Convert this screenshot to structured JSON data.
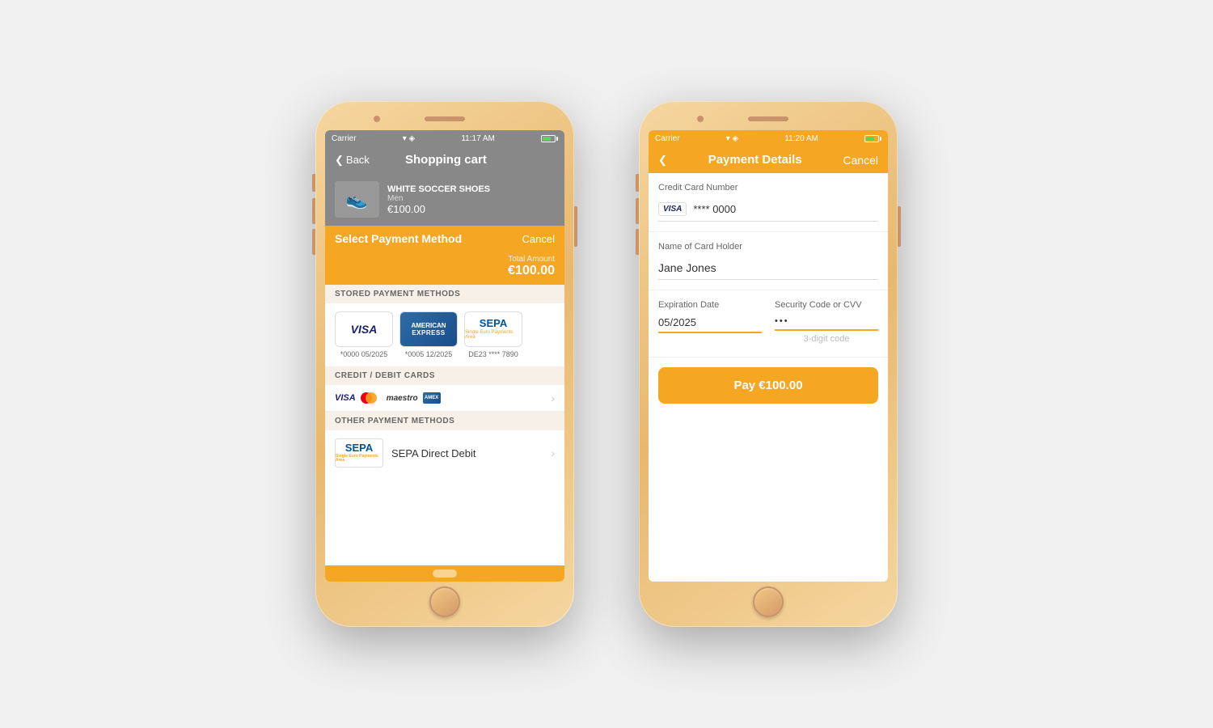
{
  "phone1": {
    "statusBar": {
      "carrier": "Carrier",
      "wifi": "wifi",
      "time": "11:17 AM",
      "battery": "battery"
    },
    "navBar": {
      "backLabel": "Back",
      "title": "Shopping cart"
    },
    "product": {
      "name": "WHITE SOCCER SHOES",
      "category": "Men",
      "price": "€100.00"
    },
    "paymentBanner": {
      "title": "Select Payment Method",
      "cancel": "Cancel"
    },
    "total": {
      "label": "Total Amount",
      "amount": "€100.00"
    },
    "storedSection": {
      "header": "STORED PAYMENT METHODS",
      "cards": [
        {
          "type": "visa",
          "label": "*0000 05/2025"
        },
        {
          "type": "amex",
          "label": "*0005 12/2025"
        },
        {
          "type": "sepa",
          "label": "DE23 **** 7890"
        }
      ]
    },
    "creditSection": {
      "header": "CREDIT / DEBIT CARDS",
      "logos": [
        "VISA",
        "Mastercard",
        "Maestro",
        "AmEx"
      ]
    },
    "otherSection": {
      "header": "OTHER PAYMENT METHODS",
      "sepaLabel": "SEPA Direct Debit"
    }
  },
  "phone2": {
    "statusBar": {
      "carrier": "Carrier",
      "wifi": "wifi",
      "time": "11:20 AM",
      "battery": "battery"
    },
    "navBar": {
      "backIcon": "back",
      "title": "Payment Details",
      "cancel": "Cancel"
    },
    "form": {
      "cardNumberLabel": "Credit Card Number",
      "cardBrand": "VISA",
      "cardMasked": "**** 0000",
      "cardHolderLabel": "Name of Card Holder",
      "cardHolderValue": "Jane Jones",
      "expirationLabel": "Expiration Date",
      "expirationValue": "05/2025",
      "cvvLabel": "Security Code or CVV",
      "cvvValue": "•••",
      "cvvPlaceholder": "3-digit code",
      "payButton": "Pay €100.00"
    }
  }
}
